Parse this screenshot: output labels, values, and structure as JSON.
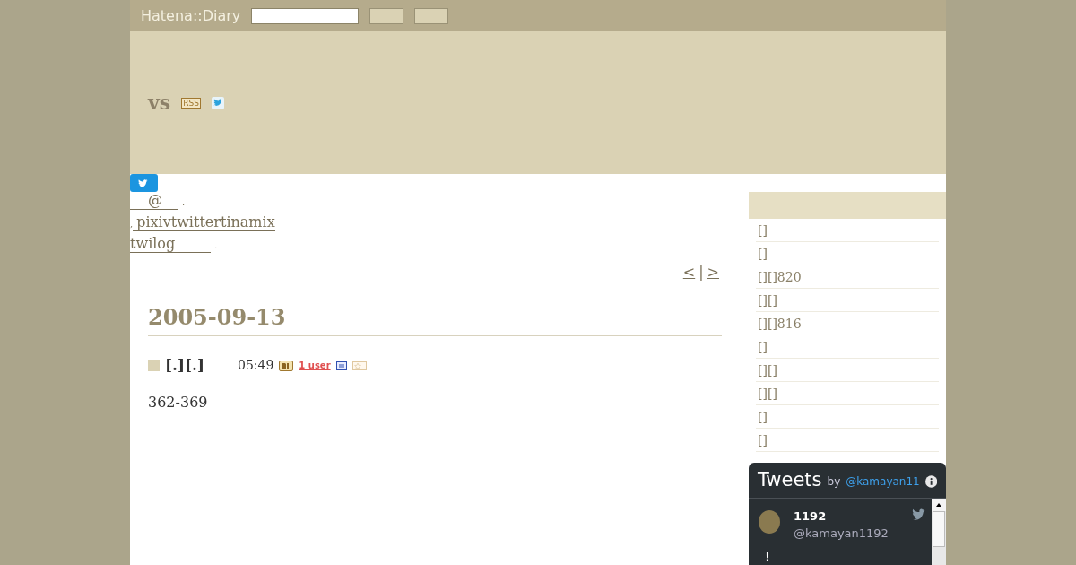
{
  "topbar": {
    "logo": "Hatena::Diary"
  },
  "header": {
    "title": "vs",
    "rss": "RSS"
  },
  "profile_links": [
    {
      "link": "@",
      "suffix": "."
    },
    {
      "prefix": ",",
      "link": "pixivtwittertinamix"
    },
    {
      "link": "twilog",
      "suffix": "."
    }
  ],
  "pager": {
    "prev": "<",
    "separator": "|",
    "next": ">"
  },
  "day": {
    "date": "2005-09-13",
    "entry": {
      "title": "[.][.]",
      "time": "05:49",
      "bookmark_count": "1 user",
      "body": "362-369"
    }
  },
  "sidebar": {
    "items": [
      "[]",
      "[]",
      "[][]820",
      "[][]",
      "[][]816",
      "[]",
      "[][]",
      "[][]",
      "[]",
      "[]"
    ]
  },
  "tweets": {
    "title": "Tweets",
    "by": "by",
    "handle": "@kamayan11",
    "tweet": {
      "name": "1192",
      "handle": "@kamayan1192",
      "text": "!"
    }
  }
}
